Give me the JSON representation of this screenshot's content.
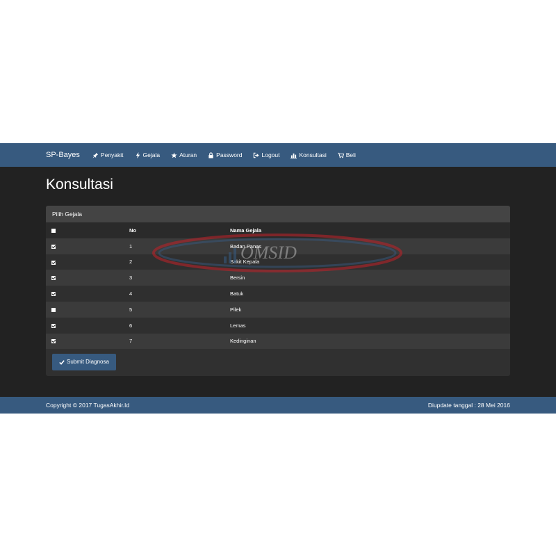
{
  "navbar": {
    "brand": "SP-Bayes",
    "items": [
      {
        "label": "Penyakit",
        "icon": "pushpin-icon"
      },
      {
        "label": "Gejala",
        "icon": "flash-icon"
      },
      {
        "label": "Aturan",
        "icon": "star-icon"
      },
      {
        "label": "Password",
        "icon": "lock-icon"
      },
      {
        "label": "Logout",
        "icon": "logout-icon"
      },
      {
        "label": "Konsultasi",
        "icon": "stats-icon"
      },
      {
        "label": "Beli",
        "icon": "cart-icon"
      }
    ]
  },
  "page": {
    "title": "Konsultasi"
  },
  "panel": {
    "heading": "Pilih Gejala",
    "columns": [
      "",
      "No",
      "Nama Gejala"
    ],
    "header_checked": false,
    "rows": [
      {
        "checked": true,
        "no": "1",
        "name": "Badan Panas"
      },
      {
        "checked": true,
        "no": "2",
        "name": "Sakit Kepala"
      },
      {
        "checked": true,
        "no": "3",
        "name": "Bersin"
      },
      {
        "checked": true,
        "no": "4",
        "name": "Batuk"
      },
      {
        "checked": false,
        "no": "5",
        "name": "Pilek"
      },
      {
        "checked": true,
        "no": "6",
        "name": "Lemas"
      },
      {
        "checked": true,
        "no": "7",
        "name": "Kedinginan"
      }
    ],
    "submit_label": "Submit Diagnosa"
  },
  "footer": {
    "copyright": "Copyright © 2017 TugasAkhir.Id",
    "updated": "Diupdate tanggal : 28 Mei 2016"
  },
  "watermark": {
    "text": "OMSID"
  },
  "colors": {
    "primary": "#375a7f",
    "background": "#222222",
    "panel": "#303030"
  }
}
